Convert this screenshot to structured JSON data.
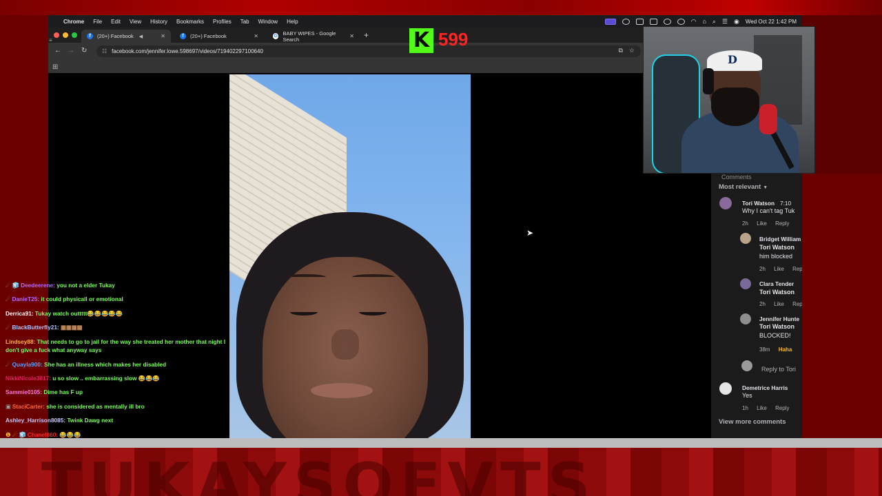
{
  "menubar": {
    "app": "Chrome",
    "items": [
      "File",
      "Edit",
      "View",
      "History",
      "Bookmarks",
      "Profiles",
      "Tab",
      "Window",
      "Help"
    ],
    "clock": "Wed Oct 22  1:42 PM"
  },
  "tabs": [
    {
      "title": "(20+) Facebook",
      "favicon": "facebook-icon",
      "active": true,
      "audio": true
    },
    {
      "title": "(20+) Facebook",
      "favicon": "facebook-icon",
      "active": false
    },
    {
      "title": "BABY WIPES - Google Search",
      "favicon": "google-icon",
      "active": false
    }
  ],
  "address_bar": {
    "url": "facebook.com/jennifer.lowe.598697/videos/719402297100640"
  },
  "kick": {
    "count": "599",
    "color": "#53fc18",
    "count_color": "#ff2424"
  },
  "chat": [
    {
      "user": "Deedeerene:",
      "text": "you not a elder Tukay",
      "color": "#b86bff",
      "badges": "☄ 🧊"
    },
    {
      "user": "DanieT25:",
      "text": "it could physicall or emotional",
      "color": "#b86bff",
      "badges": "☄"
    },
    {
      "user": "Derrica91:",
      "text": "Tukay watch outtttt😂😂😂😂😂",
      "color": "#ffffff",
      "badges": ""
    },
    {
      "user": "BlackButterfly21:",
      "text": "▦▦▦▦",
      "color": "#b0c4ff",
      "badges": "☄"
    },
    {
      "user": "Lindsey88:",
      "text": "That needs to go to jail for the way she treated her mother that night I don't give a fuck what anyway says",
      "color": "#ffb347",
      "badges": ""
    },
    {
      "user": "Quayla900:",
      "text": "She has an illness which makes her disabled",
      "color": "#5aa0ff",
      "badges": "☄"
    },
    {
      "user": "NikkiNicole3817:",
      "text": "u so slow .. embarrassing slow 😂😂😂",
      "color": "#e0245e",
      "badges": ""
    },
    {
      "user": "Sammie0105:",
      "text": "Dime has F up",
      "color": "#ff7ad9",
      "badges": ""
    },
    {
      "user": "StaciCarter:",
      "text": "she is considered as mentally ill bro",
      "color": "#ff6a3d",
      "badges": "▣"
    },
    {
      "user": "Ashley_Harrison8085:",
      "text": "Twink Dawg next",
      "color": "#c8c8ff",
      "badges": ""
    },
    {
      "user": "Chanel860:",
      "text": "😂😂😂",
      "color": "#ff2a2a",
      "badges": "❶ ☄ 🧊"
    }
  ],
  "comments_panel": {
    "header": "Comments",
    "sort_label": "Most relevant",
    "comments": [
      {
        "name": "Tori Watson",
        "time": "7:10",
        "text": "Why I can't tag Tuk",
        "age": "2h",
        "like": "Like",
        "reply": "Reply"
      },
      {
        "name": "Bridget William",
        "mention": "Tori Watson",
        "text2": "him blocked",
        "age": "2h",
        "like": "Like",
        "reply": "Rep"
      },
      {
        "name": "Clara Tender",
        "mention": "Tori Watson",
        "age": "2h",
        "like": "Like",
        "reply": "Rep"
      },
      {
        "name": "Jennifer Hunte",
        "mention": "Tori Watson",
        "text2": "BLOCKED!",
        "age": "38m",
        "reaction": "Haha"
      },
      {
        "name": "Demetrice Harris",
        "text": "Yes",
        "age": "1h",
        "like": "Like",
        "reply": "Reply"
      }
    ],
    "reply_placeholder": "Reply to Tori",
    "view_more": "View more comments"
  },
  "overlay": {
    "brand": "TUKAYSOEVTS"
  }
}
